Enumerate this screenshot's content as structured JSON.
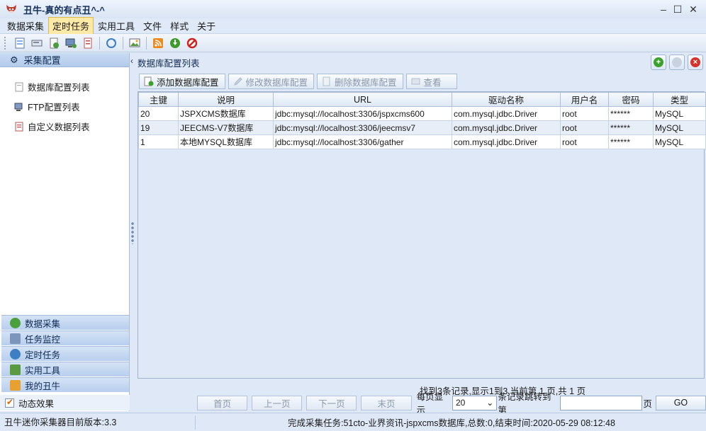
{
  "window": {
    "title": "丑牛-真的有点丑^-^",
    "minimize": "–",
    "maximize": "☐",
    "close": "✕"
  },
  "menu": [
    "数据采集",
    "定时任务",
    "实用工具",
    "文件",
    "样式",
    "关于"
  ],
  "menu_active_index": 1,
  "left_panel": {
    "header": "采集配置",
    "items": [
      "数据库配置列表",
      "FTP配置列表",
      "自定义数据列表"
    ],
    "nav_groups": [
      "数据采集",
      "任务监控",
      "定时任务",
      "实用工具",
      "我的丑牛"
    ],
    "effect_label": "动态效果",
    "effect_checked": true
  },
  "main": {
    "title": "数据库配置列表",
    "actions": {
      "add": "添加数据库配置",
      "edit": "修改数据库配置",
      "delete": "删除数据库配置",
      "view": "查看"
    },
    "columns": [
      "主键",
      "说明",
      "URL",
      "驱动名称",
      "用户名",
      "密码",
      "类型"
    ],
    "rows": [
      [
        "20",
        "JSPXCMS数据库",
        "jdbc:mysql://localhost:3306/jspxcms600",
        "com.mysql.jdbc.Driver",
        "root",
        "******",
        "MySQL"
      ],
      [
        "19",
        "JEECMS-V7数据库",
        "jdbc:mysql://localhost:3306/jeecmsv7",
        "com.mysql.jdbc.Driver",
        "root",
        "******",
        "MySQL"
      ],
      [
        "1",
        "本地MYSQL数据库",
        "jdbc:mysql://localhost:3306/gather",
        "com.mysql.jdbc.Driver",
        "root",
        "******",
        "MySQL"
      ]
    ]
  },
  "pager": {
    "info": "找到3条记录,显示1到3,当前第 1 页,共 1 页",
    "first": "首页",
    "prev": "上一页",
    "next": "下一页",
    "last": "末页",
    "page_size_label": "每页显示",
    "page_size": "20",
    "jump_label": "条记录跳转到第",
    "page_suffix": "页",
    "go": "GO"
  },
  "status": {
    "left": "丑牛迷你采集器目前版本:3.3",
    "right": "完成采集任务:51cto-业界资讯-jspxcms数据库,总数:0,结束时间:2020-05-29 08:12:48"
  }
}
